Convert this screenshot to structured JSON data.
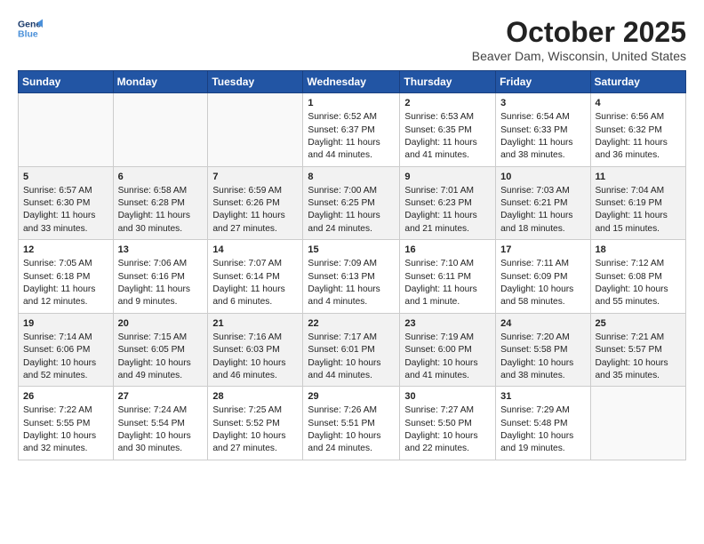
{
  "header": {
    "logo_line1": "General",
    "logo_line2": "Blue",
    "month": "October 2025",
    "location": "Beaver Dam, Wisconsin, United States"
  },
  "days_of_week": [
    "Sunday",
    "Monday",
    "Tuesday",
    "Wednesday",
    "Thursday",
    "Friday",
    "Saturday"
  ],
  "weeks": [
    [
      {
        "day": "",
        "info": ""
      },
      {
        "day": "",
        "info": ""
      },
      {
        "day": "",
        "info": ""
      },
      {
        "day": "1",
        "info": "Sunrise: 6:52 AM\nSunset: 6:37 PM\nDaylight: 11 hours and 44 minutes."
      },
      {
        "day": "2",
        "info": "Sunrise: 6:53 AM\nSunset: 6:35 PM\nDaylight: 11 hours and 41 minutes."
      },
      {
        "day": "3",
        "info": "Sunrise: 6:54 AM\nSunset: 6:33 PM\nDaylight: 11 hours and 38 minutes."
      },
      {
        "day": "4",
        "info": "Sunrise: 6:56 AM\nSunset: 6:32 PM\nDaylight: 11 hours and 36 minutes."
      }
    ],
    [
      {
        "day": "5",
        "info": "Sunrise: 6:57 AM\nSunset: 6:30 PM\nDaylight: 11 hours and 33 minutes."
      },
      {
        "day": "6",
        "info": "Sunrise: 6:58 AM\nSunset: 6:28 PM\nDaylight: 11 hours and 30 minutes."
      },
      {
        "day": "7",
        "info": "Sunrise: 6:59 AM\nSunset: 6:26 PM\nDaylight: 11 hours and 27 minutes."
      },
      {
        "day": "8",
        "info": "Sunrise: 7:00 AM\nSunset: 6:25 PM\nDaylight: 11 hours and 24 minutes."
      },
      {
        "day": "9",
        "info": "Sunrise: 7:01 AM\nSunset: 6:23 PM\nDaylight: 11 hours and 21 minutes."
      },
      {
        "day": "10",
        "info": "Sunrise: 7:03 AM\nSunset: 6:21 PM\nDaylight: 11 hours and 18 minutes."
      },
      {
        "day": "11",
        "info": "Sunrise: 7:04 AM\nSunset: 6:19 PM\nDaylight: 11 hours and 15 minutes."
      }
    ],
    [
      {
        "day": "12",
        "info": "Sunrise: 7:05 AM\nSunset: 6:18 PM\nDaylight: 11 hours and 12 minutes."
      },
      {
        "day": "13",
        "info": "Sunrise: 7:06 AM\nSunset: 6:16 PM\nDaylight: 11 hours and 9 minutes."
      },
      {
        "day": "14",
        "info": "Sunrise: 7:07 AM\nSunset: 6:14 PM\nDaylight: 11 hours and 6 minutes."
      },
      {
        "day": "15",
        "info": "Sunrise: 7:09 AM\nSunset: 6:13 PM\nDaylight: 11 hours and 4 minutes."
      },
      {
        "day": "16",
        "info": "Sunrise: 7:10 AM\nSunset: 6:11 PM\nDaylight: 11 hours and 1 minute."
      },
      {
        "day": "17",
        "info": "Sunrise: 7:11 AM\nSunset: 6:09 PM\nDaylight: 10 hours and 58 minutes."
      },
      {
        "day": "18",
        "info": "Sunrise: 7:12 AM\nSunset: 6:08 PM\nDaylight: 10 hours and 55 minutes."
      }
    ],
    [
      {
        "day": "19",
        "info": "Sunrise: 7:14 AM\nSunset: 6:06 PM\nDaylight: 10 hours and 52 minutes."
      },
      {
        "day": "20",
        "info": "Sunrise: 7:15 AM\nSunset: 6:05 PM\nDaylight: 10 hours and 49 minutes."
      },
      {
        "day": "21",
        "info": "Sunrise: 7:16 AM\nSunset: 6:03 PM\nDaylight: 10 hours and 46 minutes."
      },
      {
        "day": "22",
        "info": "Sunrise: 7:17 AM\nSunset: 6:01 PM\nDaylight: 10 hours and 44 minutes."
      },
      {
        "day": "23",
        "info": "Sunrise: 7:19 AM\nSunset: 6:00 PM\nDaylight: 10 hours and 41 minutes."
      },
      {
        "day": "24",
        "info": "Sunrise: 7:20 AM\nSunset: 5:58 PM\nDaylight: 10 hours and 38 minutes."
      },
      {
        "day": "25",
        "info": "Sunrise: 7:21 AM\nSunset: 5:57 PM\nDaylight: 10 hours and 35 minutes."
      }
    ],
    [
      {
        "day": "26",
        "info": "Sunrise: 7:22 AM\nSunset: 5:55 PM\nDaylight: 10 hours and 32 minutes."
      },
      {
        "day": "27",
        "info": "Sunrise: 7:24 AM\nSunset: 5:54 PM\nDaylight: 10 hours and 30 minutes."
      },
      {
        "day": "28",
        "info": "Sunrise: 7:25 AM\nSunset: 5:52 PM\nDaylight: 10 hours and 27 minutes."
      },
      {
        "day": "29",
        "info": "Sunrise: 7:26 AM\nSunset: 5:51 PM\nDaylight: 10 hours and 24 minutes."
      },
      {
        "day": "30",
        "info": "Sunrise: 7:27 AM\nSunset: 5:50 PM\nDaylight: 10 hours and 22 minutes."
      },
      {
        "day": "31",
        "info": "Sunrise: 7:29 AM\nSunset: 5:48 PM\nDaylight: 10 hours and 19 minutes."
      },
      {
        "day": "",
        "info": ""
      }
    ]
  ]
}
